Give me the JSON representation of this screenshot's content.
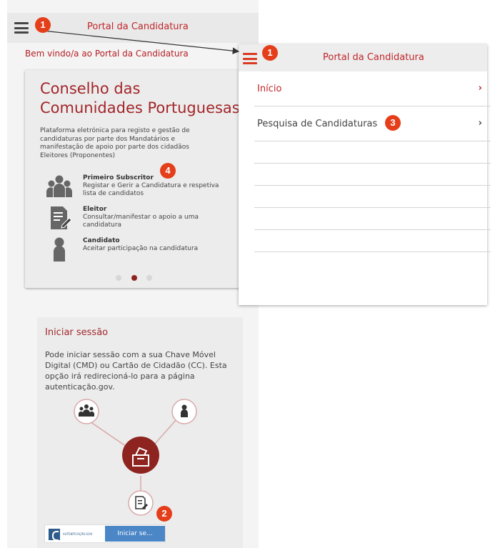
{
  "left_screen": {
    "header_title": "Portal da Candidatura",
    "welcome": "Bem vindo/a ao Portal da Candidatura",
    "carousel": {
      "title": "Conselho das Comunidades Portuguesas",
      "description": "Plataforma eletrónica para registo e gestão de candidaturas por parte dos Mandatários e manifestação de apoio por parte dos cidadãos Eleitores (Proponentes)",
      "roles": [
        {
          "title": "Primeiro Subscritor",
          "text": "Registar e Gerir a Candidatura e respetiva lista de candidatos",
          "icon": "group-icon"
        },
        {
          "title": "Eleitor",
          "text": "Consultar/manifestar o apoio a uma candidatura",
          "icon": "document-edit-icon"
        },
        {
          "title": "Candidato",
          "text": "Aceitar participação na candidatura",
          "icon": "person-icon"
        }
      ],
      "slides": 3,
      "active_slide": 2
    },
    "login": {
      "title": "Iniciar sessão",
      "text": "Pode iniciar sessão com a sua Chave Móvel Digital (CMD) ou Cartão de Cidadão (CC). Esta opção irá redirecioná-lo para a página autenticação.gov.",
      "logo_text": "AUTENTICAÇÃO.GOV",
      "button": "Iniciar se..."
    }
  },
  "right_screen": {
    "header_title": "Portal da Candidatura",
    "menu": [
      {
        "label": "Início",
        "chevron": "›",
        "active": true
      },
      {
        "label": "Pesquisa de Candidaturas",
        "chevron": "›",
        "active": false
      }
    ],
    "empty_rows": 5
  },
  "markers": {
    "m1a": "1",
    "m1b": "1",
    "m2": "2",
    "m3": "3",
    "m4": "4"
  },
  "colors": {
    "brand_red": "#c0262b",
    "marker": "#e43f1a",
    "dark_red": "#8e2420",
    "button_blue": "#4b86c6"
  }
}
